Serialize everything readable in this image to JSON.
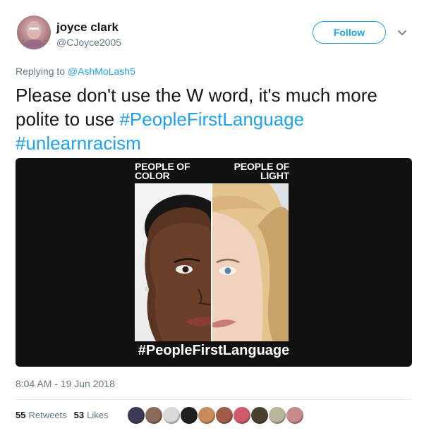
{
  "user": {
    "name": "joyce clark",
    "handle": "@CJoyce2005",
    "avatar_icon": "profile-avatar"
  },
  "follow_label": "Follow",
  "reply": {
    "prefix": "Replying to ",
    "to": "@AshMoLash5"
  },
  "tweet": {
    "text": "Please don't use the W word, it's much more polite to use ",
    "hashtags": [
      "#PeopleFirstLanguage",
      "#unlearnracism"
    ]
  },
  "media": {
    "label_left_1": "PEOPLE OF",
    "label_left_2": "COLOR",
    "label_right_1": "PEOPLE OF",
    "label_right_2": "LIGHT",
    "caption": "#PeopleFirstLanguage"
  },
  "timestamp": "8:04 AM - 19 Jun 2018",
  "stats": {
    "retweets_count": "55",
    "retweets_label": "Retweets",
    "likes_count": "53",
    "likes_label": "Likes"
  },
  "likers": [
    {
      "color": "#3b3b58"
    },
    {
      "color": "#8a6a58"
    },
    {
      "color": "#d9d9d9"
    },
    {
      "color": "#1f1f1f"
    },
    {
      "color": "#c98b5a"
    },
    {
      "color": "#a15b4a"
    },
    {
      "color": "#d05a6a"
    },
    {
      "color": "#4a4030"
    },
    {
      "color": "#b9b69b"
    },
    {
      "color": "#c98a8a"
    }
  ],
  "colors": {
    "accent": "#1da1f2",
    "secondary_text": "#657786"
  }
}
